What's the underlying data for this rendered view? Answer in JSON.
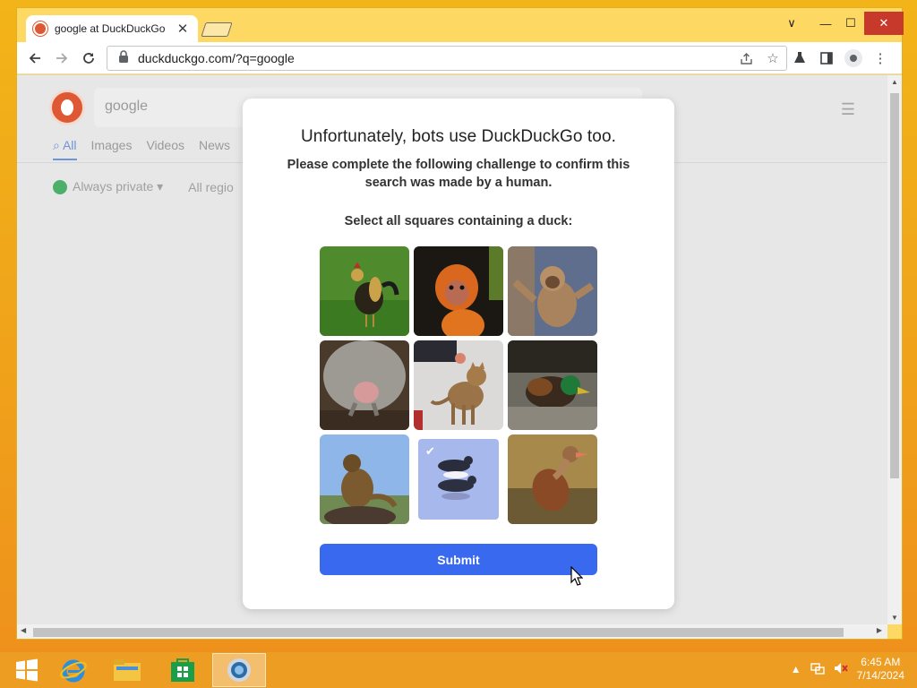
{
  "browser": {
    "tab_title": "google at DuckDuckGo",
    "tab_close": "✕",
    "url": "duckduckgo.com/?q=google",
    "controls": {
      "menu_chevron": "∨",
      "minimize": "—",
      "maximize": "☐",
      "close": "✕"
    },
    "toolbar_icons": [
      "back-icon",
      "forward-icon",
      "reload-icon",
      "lock-icon",
      "share-icon",
      "star-icon",
      "extension-icon",
      "sidepanel-icon",
      "profile-icon",
      "kebab-menu-icon"
    ]
  },
  "page": {
    "search_query": "google",
    "tabs": [
      "All",
      "Images",
      "Videos",
      "News"
    ],
    "filters": [
      "Always private ▾",
      "All regio"
    ]
  },
  "modal": {
    "title": "Unfortunately, bots use DuckDuckGo too.",
    "subtitle": "Please complete the following challenge to confirm this search was made by a human.",
    "instruction": "Select all squares containing a duck:",
    "images": [
      {
        "subject": "rooster",
        "selected": false
      },
      {
        "subject": "orange-monkey",
        "selected": false
      },
      {
        "subject": "gibbon",
        "selected": false
      },
      {
        "subject": "kangaroo-joey",
        "selected": false
      },
      {
        "subject": "cat",
        "selected": false
      },
      {
        "subject": "mallard-duck",
        "selected": false
      },
      {
        "subject": "monkey-on-rock",
        "selected": false
      },
      {
        "subject": "ducks-on-water",
        "selected": true
      },
      {
        "subject": "whistling-duck",
        "selected": false
      }
    ],
    "submit_label": "Submit"
  },
  "taskbar": {
    "apps": [
      "start-icon",
      "internet-explorer-icon",
      "file-explorer-icon",
      "store-icon",
      "chrome-icon"
    ],
    "time": "6:45 AM",
    "date": "7/14/2024"
  },
  "colors": {
    "accent": "#3969ef",
    "ddg": "#de5833",
    "taskbar": "#ec9e24"
  }
}
